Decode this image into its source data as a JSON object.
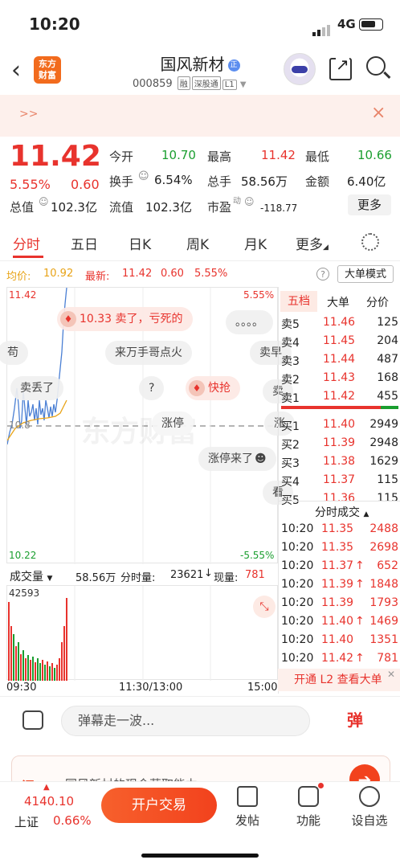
{
  "status_bar": {
    "time": "10:20",
    "network": "4G"
  },
  "header": {
    "title": "国风新材",
    "title_badge": "正",
    "code": "000859",
    "tags": [
      "融",
      "深股通",
      "L1"
    ],
    "logo_text_1": "东方",
    "logo_text_2": "财富"
  },
  "banner": {
    "arrows": ">>",
    "close": "×"
  },
  "quote": {
    "price": "11.42",
    "change_pct": "5.55%",
    "change": "0.60",
    "stats": [
      {
        "label": "今开",
        "value": "10.70",
        "color": "green"
      },
      {
        "label": "最高",
        "value": "11.42",
        "color": "red"
      },
      {
        "label": "最低",
        "value": "10.66",
        "color": "green"
      },
      {
        "label": "换手",
        "value": "6.54%",
        "color": "black"
      },
      {
        "label": "总手",
        "value": "58.56万",
        "color": "black"
      },
      {
        "label": "金额",
        "value": "6.40亿",
        "color": "black"
      },
      {
        "label": "总值",
        "value": "102.3亿",
        "color": "black"
      },
      {
        "label": "流值",
        "value": "102.3亿",
        "color": "black"
      },
      {
        "label": "市盈",
        "value": "-118.77",
        "color": "black",
        "superscript": "动"
      }
    ],
    "more_label": "更多"
  },
  "tabs": [
    "分时",
    "五日",
    "日K",
    "周K",
    "月K",
    "更多"
  ],
  "chart_header": {
    "avg_label": "均价:",
    "avg_value": "10.92",
    "latest_label": "最新:",
    "latest_value": "11.42",
    "latest_change": "0.60",
    "latest_pct": "5.55%",
    "help": "?",
    "big_order_mode": "大单模式"
  },
  "chart_axis": {
    "top_price": "11.42",
    "top_pct": "5.55%",
    "bottom_price": "10.22",
    "bottom_pct": "-5.55%",
    "mid_label": "10.8"
  },
  "danmu": [
    "10.33 卖了，亏死的",
    "。。。。",
    "苟",
    "来万手哥点火",
    "卖早",
    "卖丢了",
    "?",
    "快抢",
    "卖",
    "涨停",
    "涨",
    "涨停来了",
    "看"
  ],
  "watermark": "东方财富",
  "volume": {
    "label": "成交量",
    "total": "58.56万",
    "time_volume_label": "分时量:",
    "time_volume": "23621",
    "current_label": "现量:",
    "current": "781",
    "axis_max": "42593"
  },
  "time_axis": [
    "09:30",
    "11:30/13:00",
    "15:00"
  ],
  "orderbook": {
    "tabs": [
      "五档",
      "大单",
      "分价"
    ],
    "asks": [
      {
        "label": "卖5",
        "price": "11.46",
        "vol": "125"
      },
      {
        "label": "卖4",
        "price": "11.45",
        "vol": "204"
      },
      {
        "label": "卖3",
        "price": "11.44",
        "vol": "487"
      },
      {
        "label": "卖2",
        "price": "11.43",
        "vol": "168"
      },
      {
        "label": "卖1",
        "price": "11.42",
        "vol": "455"
      }
    ],
    "bids": [
      {
        "label": "买1",
        "price": "11.40",
        "vol": "2949"
      },
      {
        "label": "买2",
        "price": "11.39",
        "vol": "2948"
      },
      {
        "label": "买3",
        "price": "11.38",
        "vol": "1629"
      },
      {
        "label": "买4",
        "price": "11.37",
        "vol": "115"
      },
      {
        "label": "买5",
        "price": "11.36",
        "vol": "115"
      }
    ]
  },
  "trades": {
    "title": "分时成交",
    "rows": [
      {
        "time": "10:20",
        "price": "11.35",
        "vol": "2488",
        "dir": "",
        "color": "red"
      },
      {
        "time": "10:20",
        "price": "11.35",
        "vol": "2698",
        "dir": "",
        "color": "red"
      },
      {
        "time": "10:20",
        "price": "11.37",
        "vol": "652",
        "dir": "↑",
        "color": "red"
      },
      {
        "time": "10:20",
        "price": "11.39",
        "vol": "1848",
        "dir": "↑",
        "color": "red"
      },
      {
        "time": "10:20",
        "price": "11.39",
        "vol": "1793",
        "dir": "",
        "color": "red"
      },
      {
        "time": "10:20",
        "price": "11.40",
        "vol": "1469",
        "dir": "↑",
        "color": "red"
      },
      {
        "time": "10:20",
        "price": "11.40",
        "vol": "1351",
        "dir": "",
        "color": "red"
      },
      {
        "time": "10:20",
        "price": "11.42",
        "vol": "781",
        "dir": "↑",
        "color": "red"
      }
    ],
    "l2_label": "开通 L2 查看大单"
  },
  "message_bar": {
    "placeholder": "弹幕走一波...",
    "send_label": "弹"
  },
  "ai_strip": {
    "brand": "问Ai",
    "text": "国风新材的现金获取能力"
  },
  "bottom_nav": {
    "index_value": "4140.10",
    "index_name": "上证",
    "index_pct": "0.66%",
    "trade_button": "开户交易",
    "items": [
      "发帖",
      "功能",
      "设自选"
    ]
  },
  "colors": {
    "up": "#e8332d",
    "down": "#1a9e2f",
    "accent": "#f2421d",
    "avg_line": "#e8a317",
    "price_line": "#4a7fd4"
  }
}
